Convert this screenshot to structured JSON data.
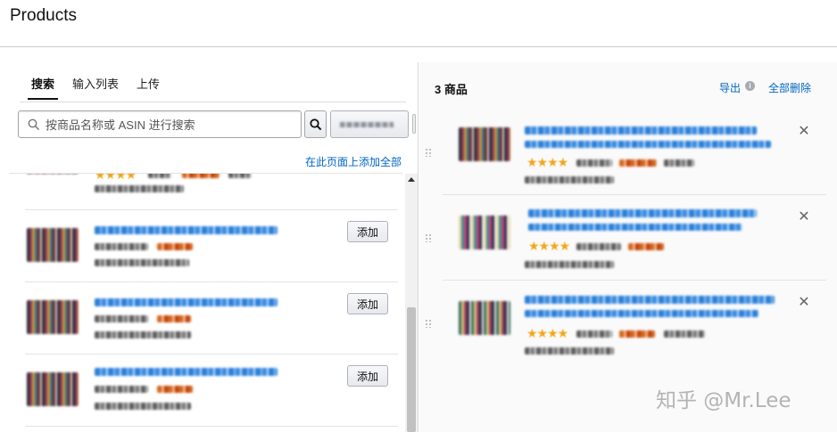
{
  "page": {
    "title": "Products"
  },
  "left_panel": {
    "tabs": [
      {
        "label": "搜索",
        "active": true
      },
      {
        "label": "输入列表",
        "active": false
      },
      {
        "label": "上传",
        "active": false
      }
    ],
    "search": {
      "placeholder": "按商品名称或 ASIN 进行搜索",
      "value": ""
    },
    "add_all_label": "在此页面上添加全部",
    "add_button_label": "添加"
  },
  "right_panel": {
    "count_label": "3 商品",
    "export_label": "导出",
    "delete_all_label": "全部删除"
  },
  "watermark": "知乎 @Mr.Lee",
  "colors": {
    "link": "#0066c0",
    "star": "#f2a416",
    "price": "#c2410c"
  },
  "icons": {
    "search": "search-icon",
    "info": "info-icon",
    "close": "close-icon",
    "drag": "drag-handle-icon",
    "scroll_up": "scroll-up-arrow-icon"
  }
}
